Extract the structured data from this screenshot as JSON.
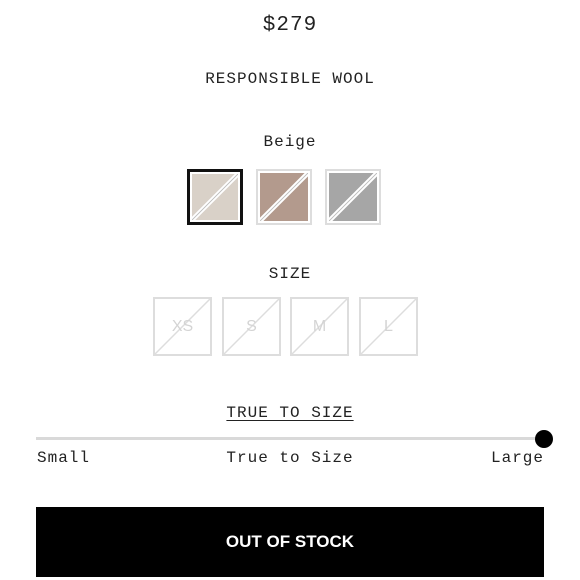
{
  "product": {
    "price": "$279",
    "material": "RESPONSIBLE WOOL"
  },
  "color": {
    "selected_label": "Beige",
    "swatches": [
      {
        "name": "Beige",
        "color": "#d9d1c8",
        "selected": true,
        "unavailable": true
      },
      {
        "name": "Mauve",
        "color": "#b39a8d",
        "selected": false,
        "unavailable": true
      },
      {
        "name": "Grey",
        "color": "#a6a6a6",
        "selected": false,
        "unavailable": true
      }
    ]
  },
  "size": {
    "label": "SIZE",
    "options": [
      "XS",
      "S",
      "M",
      "L"
    ]
  },
  "fit": {
    "title": "TRUE TO SIZE",
    "small": "Small",
    "true": "True to Size",
    "large": "Large",
    "value": 1.0
  },
  "button": {
    "label": "OUT OF STOCK"
  }
}
